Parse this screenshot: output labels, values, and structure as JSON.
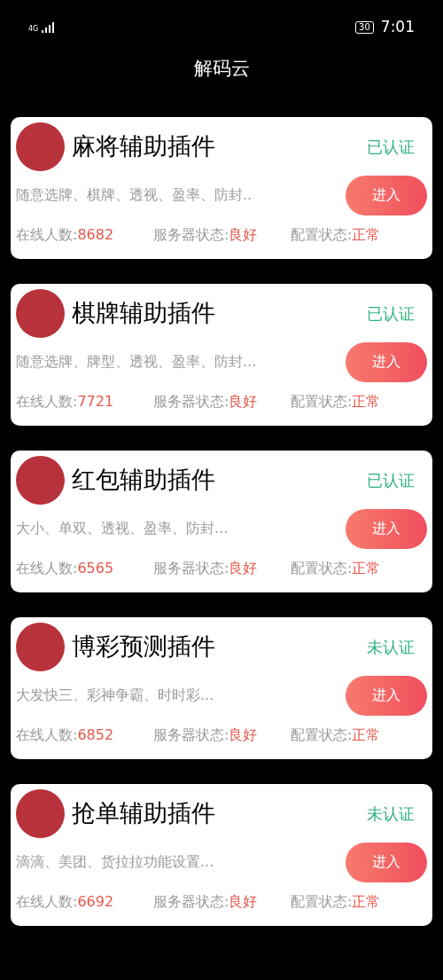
{
  "status_bar": {
    "network": "4G",
    "battery": "30",
    "time": "7:01"
  },
  "header": {
    "title": "解码云"
  },
  "cards": [
    {
      "title": "麻将辅助插件",
      "status": "已认证",
      "description": "随意选牌、棋牌、透视、盈率、防封..",
      "button": "进入",
      "online_label": "在线人数:",
      "online": "8682",
      "server_label": "服务器状态:",
      "server": "良好",
      "config_label": "配置状态:",
      "config": "正常"
    },
    {
      "title": "棋牌辅助插件",
      "status": "已认证",
      "description": "随意选牌、牌型、透视、盈率、防封...",
      "button": "进入",
      "online_label": "在线人数:",
      "online": "7721",
      "server_label": "服务器状态:",
      "server": "良好",
      "config_label": "配置状态:",
      "config": "正常"
    },
    {
      "title": "红包辅助插件",
      "status": "已认证",
      "description": "大小、单双、透视、盈率、防封...",
      "button": "进入",
      "online_label": "在线人数:",
      "online": "6565",
      "server_label": "服务器状态:",
      "server": "良好",
      "config_label": "配置状态:",
      "config": "正常"
    },
    {
      "title": "博彩预测插件",
      "status": "未认证",
      "description": "大发快三、彩神争霸、时时彩...",
      "button": "进入",
      "online_label": "在线人数:",
      "online": "6852",
      "server_label": "服务器状态:",
      "server": "良好",
      "config_label": "配置状态:",
      "config": "正常"
    },
    {
      "title": "抢单辅助插件",
      "status": "未认证",
      "description": "滴滴、美团、货拉拉功能设置...",
      "button": "进入",
      "online_label": "在线人数:",
      "online": "6692",
      "server_label": "服务器状态:",
      "server": "良好",
      "config_label": "配置状态:",
      "config": "正常"
    }
  ]
}
